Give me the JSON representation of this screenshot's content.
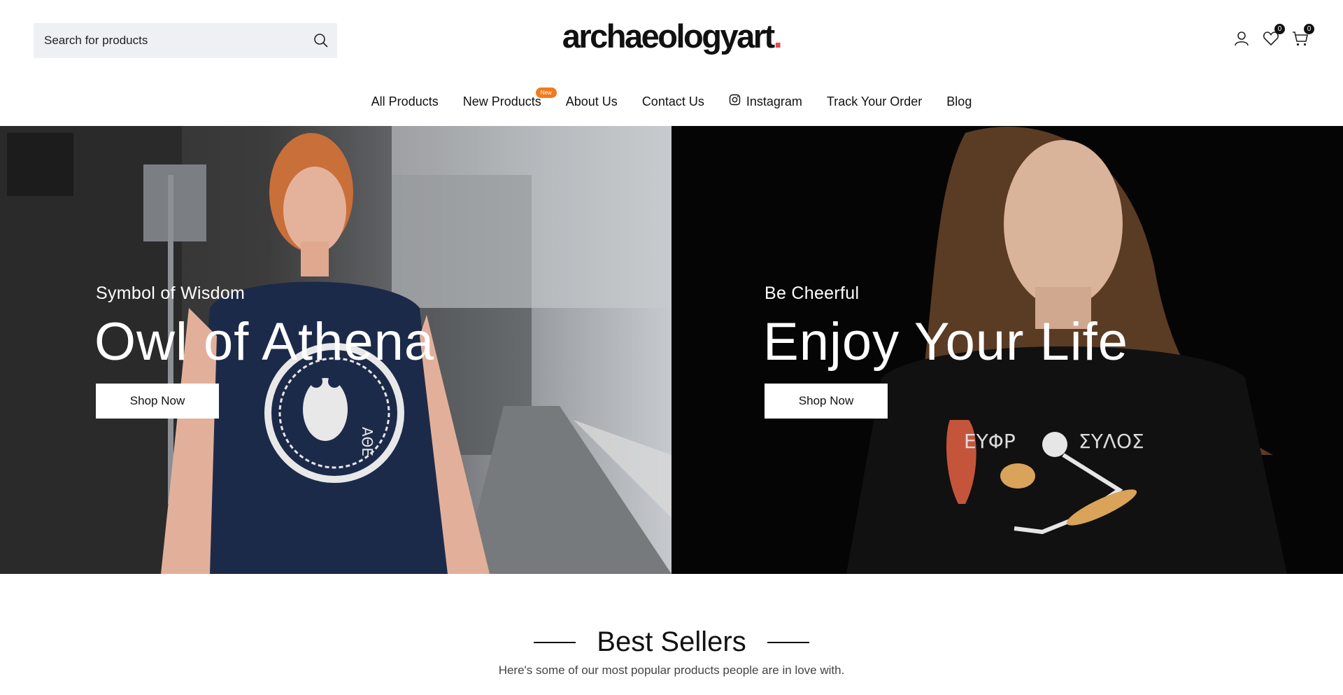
{
  "search": {
    "placeholder": "Search for products"
  },
  "header": {
    "logo_text": "archaeologyart",
    "logo_dot": ".",
    "wishlist_count": "0",
    "cart_count": "0"
  },
  "nav": {
    "items": [
      {
        "label": "All Products"
      },
      {
        "label": "New Products",
        "badge": "New"
      },
      {
        "label": "About Us"
      },
      {
        "label": "Contact Us"
      },
      {
        "label": "Instagram",
        "icon": "instagram-icon"
      },
      {
        "label": "Track Your Order"
      },
      {
        "label": "Blog"
      }
    ]
  },
  "hero": {
    "left": {
      "subtitle": "Symbol of Wisdom",
      "title": "Owl of Athena",
      "button": "Shop Now",
      "shirt_text": "ΑΘΕ"
    },
    "right": {
      "subtitle": "Be Cheerful",
      "title": "Enjoy Your Life",
      "button": "Shop Now",
      "shirt_text_1": "ΕΥΦΡ",
      "shirt_text_2": "ΣΥΛΟΣ"
    }
  },
  "section": {
    "title": "Best Sellers",
    "description": "Here's some of our most popular products people are in love with."
  },
  "colors": {
    "accent_badge": "#f07b1f",
    "logo_dot": "#e5484d",
    "search_bg": "#eef0f4"
  }
}
